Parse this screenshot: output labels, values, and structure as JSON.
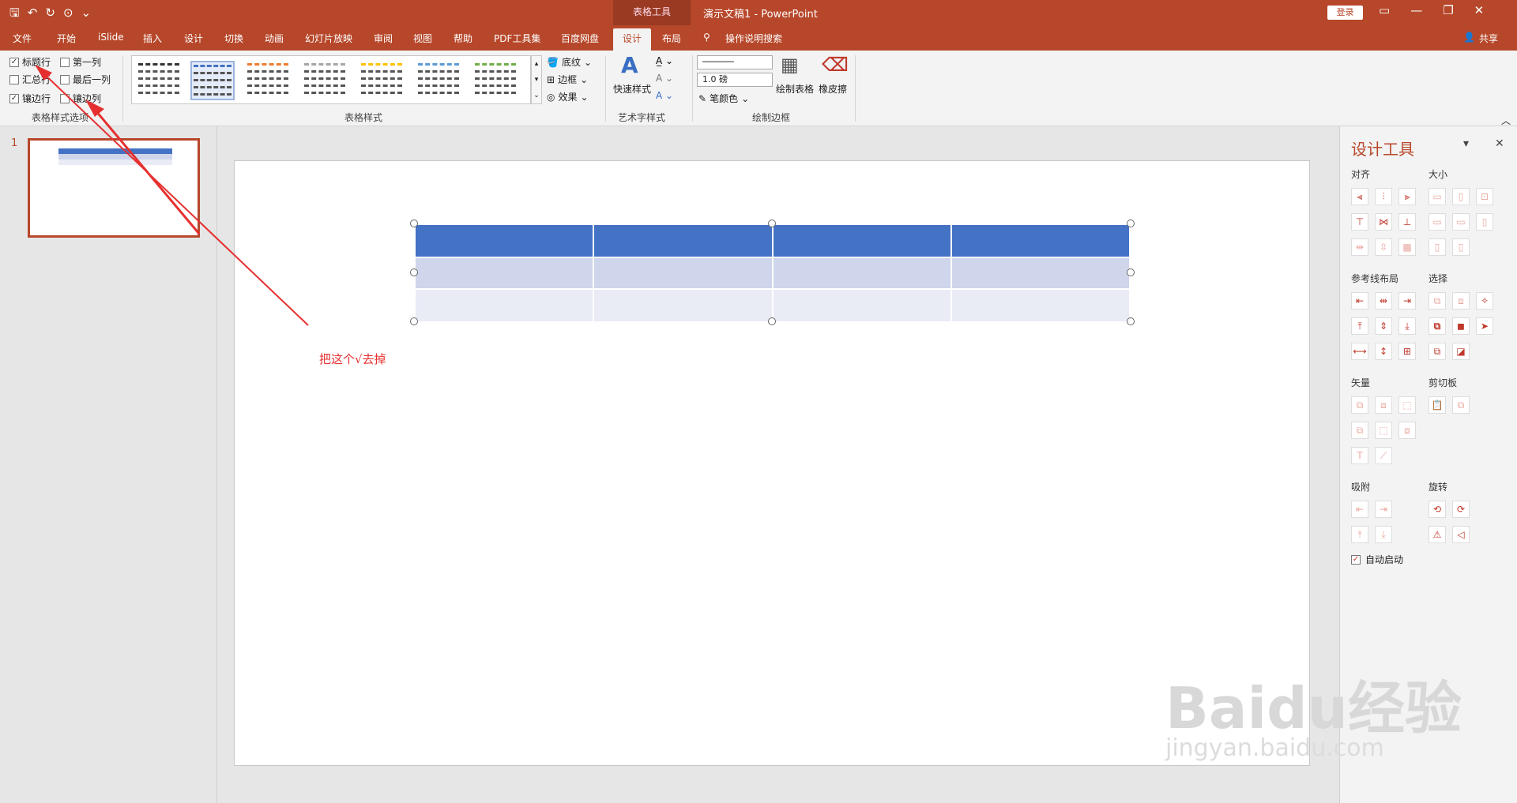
{
  "window": {
    "context_tab_group": "表格工具",
    "doc_title": "演示文稿1  -  PowerPoint",
    "login_label": "登录"
  },
  "tabs": [
    "文件",
    "开始",
    "iSlide",
    "插入",
    "设计",
    "切换",
    "动画",
    "幻灯片放映",
    "审阅",
    "视图",
    "帮助",
    "PDF工具集",
    "百度网盘",
    "设计",
    "布局"
  ],
  "tell_me": "操作说明搜索",
  "share": "共享",
  "ribbon": {
    "options_group": {
      "label": "表格样式选项",
      "items": [
        {
          "label": "标题行",
          "checked": true
        },
        {
          "label": "第一列",
          "checked": false
        },
        {
          "label": "汇总行",
          "checked": false
        },
        {
          "label": "最后一列",
          "checked": false
        },
        {
          "label": "镶边行",
          "checked": true
        },
        {
          "label": "镶边列",
          "checked": false
        }
      ]
    },
    "styles_group": {
      "label": "表格样式",
      "style_colors": [
        "#333333",
        "#4472c4",
        "#ed7d31",
        "#a5a5a5",
        "#ffc000",
        "#5b9bd5",
        "#70ad47"
      ],
      "shading": "底纹",
      "borders": "边框",
      "effects": "效果"
    },
    "wordart_group": {
      "label": "艺术字样式",
      "quick_styles": "快速样式"
    },
    "draw_group": {
      "label": "绘制边框",
      "pen_weight": "1.0 磅",
      "pen_color": "笔颜色",
      "draw_table": "绘制表格",
      "eraser": "橡皮擦"
    }
  },
  "thumbnail": {
    "number": "1"
  },
  "annotation": "把这个√去掉",
  "pane": {
    "title": "设计工具",
    "sections": {
      "align": "对齐",
      "size": "大小",
      "guides": "参考线布局",
      "select": "选择",
      "vector": "矢量",
      "clipboard": "剪切板",
      "snap": "吸附",
      "rotate": "旋转"
    },
    "auto_start": "自动启动"
  },
  "watermark": {
    "brand": "Baidu经验",
    "url": "jingyan.baidu.com"
  },
  "colors": {
    "accent": "#b7472a",
    "table_header": "#4472c4",
    "band1": "#cfd5ea",
    "band2": "#e9ebf5",
    "annotation": "#e63030"
  }
}
